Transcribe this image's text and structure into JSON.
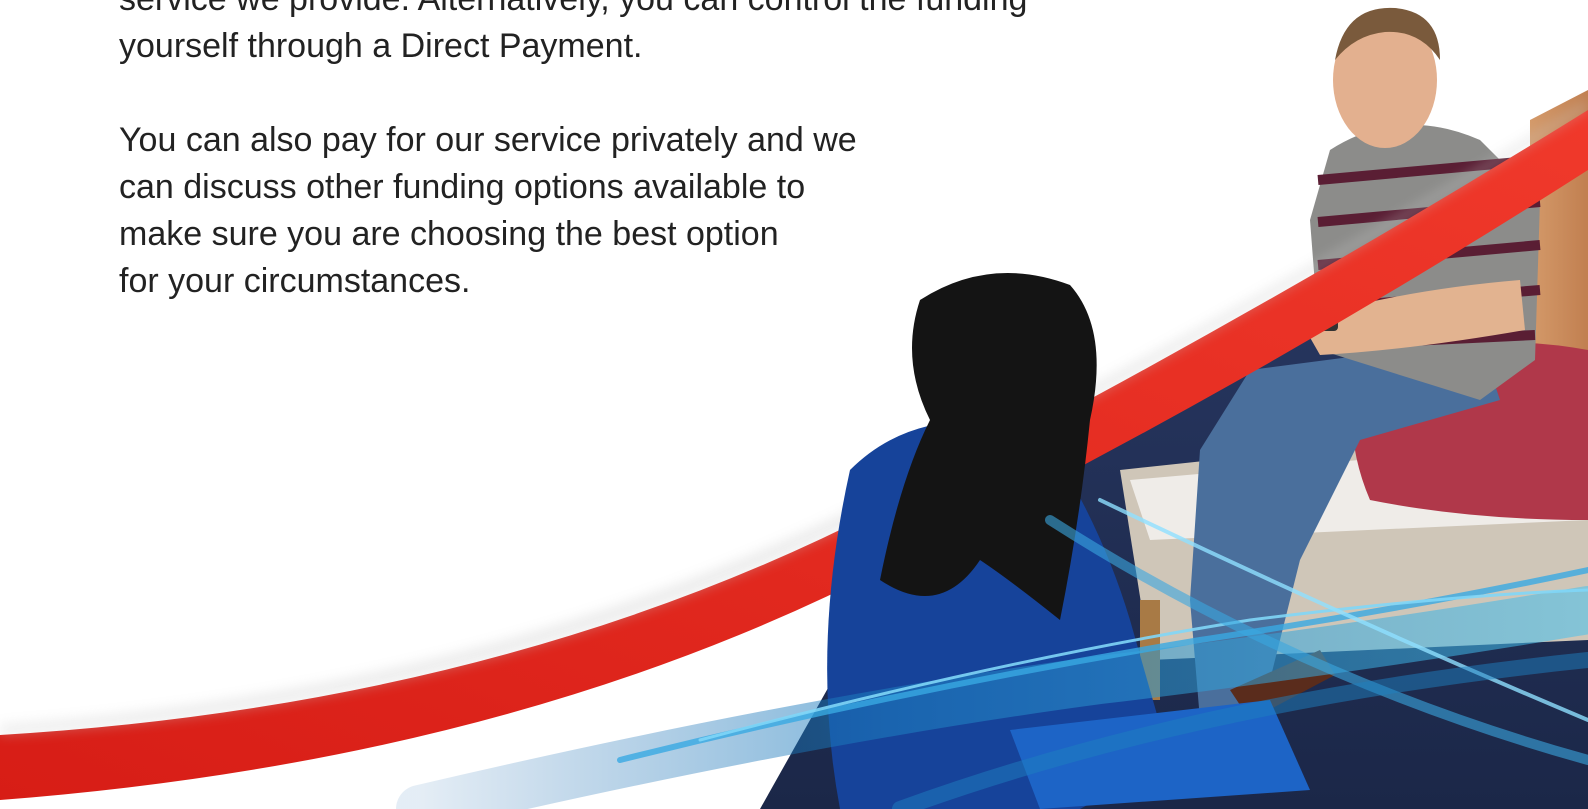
{
  "intro_lines": [
    "service we provide. Alternatively, you can control the funding",
    "yourself through a Direct Payment."
  ],
  "private_lines": [
    "You can also pay for our service privately and we",
    "can discuss other funding options available to",
    "make sure you are choosing the best option",
    "for your circumstances."
  ],
  "colors": {
    "red_swoosh": "#e8261c",
    "blue_swoosh": "#1d7fc0",
    "text": "#222222"
  }
}
